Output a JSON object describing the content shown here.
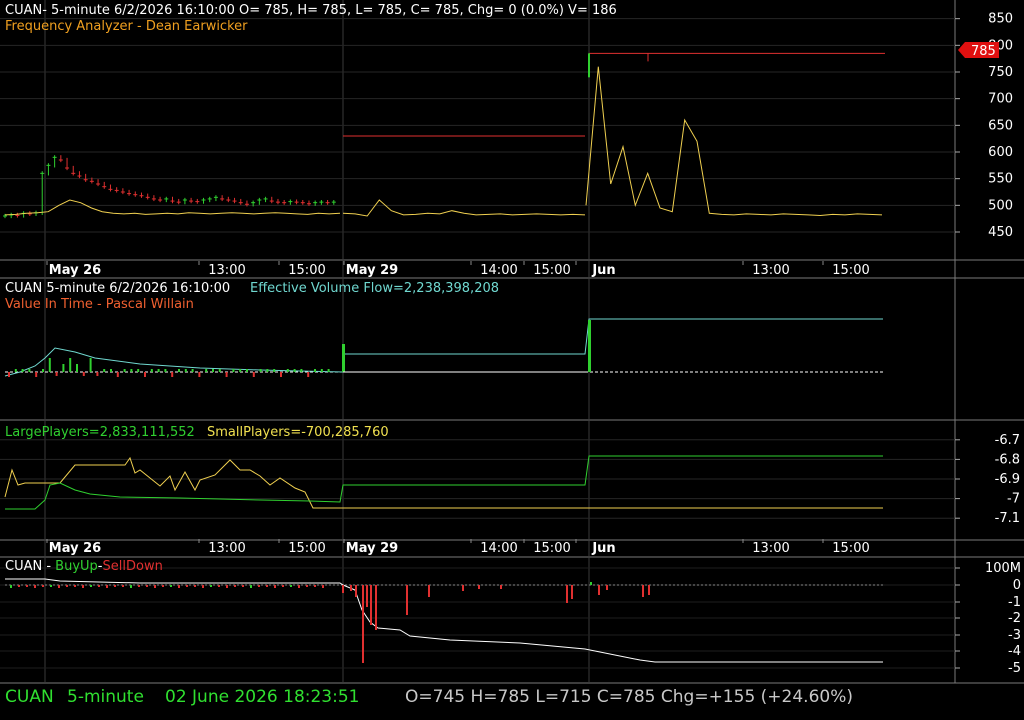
{
  "colors": {
    "background": "#000000",
    "grid": "#2e2e2e",
    "separator": "#7a7a7a",
    "white": "#ffffff",
    "yellow": "#f0d050",
    "orange": "#f08020",
    "red": "#e03030",
    "green": "#30d030",
    "cyan": "#70d8d0",
    "status_green": "#30e030",
    "gray_text": "#c8c8c8"
  },
  "panel1": {
    "header": "CUAN- 5-minute 6/2/2026 16:10:00 O= 785, H= 785, L= 785, C= 785, Chg= 0 (0.0%) V= 186",
    "subtitle": "Frequency Analyzer - Dean Earwicker",
    "last_price_tag": "785"
  },
  "panel2": {
    "header_prefix": "CUAN 5-minute  6/2/2026 16:10:00",
    "header_indicator": "Effective Volume Flow=2,238,398,208",
    "subtitle": "Value In Time - Pascal Willain"
  },
  "panel3": {
    "large_label": "LargePlayers=2,833,111,552",
    "small_label": "SmallPlayers=-700,285,760"
  },
  "panel4": {
    "label_prefix": "CUAN - ",
    "buy_label": "BuyUp",
    "dash": "-",
    "sell_label": "SellDown"
  },
  "status": {
    "symbol": "CUAN",
    "interval": "5-minute",
    "datetime": "02 June 2026 18:23:51",
    "ohlc": "O=745  H=785  L=715  C=785  Chg=+155 (+24.60%)"
  },
  "chart_data": [
    {
      "type": "candlestick",
      "name": "price",
      "ylim": [
        420,
        870
      ],
      "y_ticks": [
        850,
        800,
        750,
        700,
        650,
        600,
        550,
        500,
        450
      ],
      "x_ticks": [
        "May 26",
        "13:00",
        "15:00",
        "May 29",
        "14:00",
        "15:00",
        "Jun",
        "13:00",
        "15:00"
      ],
      "x_ticks_bold": [
        "May 26",
        "May 29",
        "Jun"
      ],
      "candle_closes_may26": [
        480,
        482,
        481,
        485,
        484,
        486,
        560,
        575,
        590,
        585,
        570,
        560,
        555,
        548,
        545,
        540,
        535,
        530,
        528,
        525,
        522,
        520,
        518,
        515,
        512,
        510,
        512,
        508,
        506,
        510,
        508,
        507,
        510,
        512,
        515,
        512,
        510,
        508,
        505,
        502,
        505,
        510,
        512,
        508,
        506,
        505,
        507,
        506,
        505,
        503,
        505,
        506,
        505,
        506
      ],
      "candles_may29": [
        {
          "x": 0.0,
          "value": 630
        },
        {
          "x": 1.0,
          "value": 630
        }
      ],
      "candles_jun": [
        {
          "x": 0.0,
          "value": 785
        },
        {
          "x": 1.0,
          "value": 785
        }
      ],
      "last_close": 785
    },
    {
      "type": "line",
      "name": "Frequency Analyzer",
      "values_may26": [
        482,
        483,
        485,
        486,
        488,
        500,
        510,
        505,
        495,
        488,
        485,
        484,
        485,
        483,
        484,
        485,
        484,
        486,
        485,
        484,
        485,
        486,
        485,
        484,
        485,
        486,
        485,
        484,
        483,
        485,
        484,
        485
      ],
      "values_may29": [
        485,
        484,
        480,
        510,
        490,
        482,
        483,
        485,
        484,
        490,
        485,
        482,
        483,
        484,
        482,
        483,
        484,
        483,
        482,
        483,
        482
      ],
      "values_jun": [
        500,
        760,
        540,
        610,
        500,
        560,
        495,
        488,
        660,
        620,
        485,
        483,
        482,
        484,
        483,
        482,
        484,
        483,
        482,
        481,
        483,
        482,
        484,
        483,
        482
      ]
    },
    {
      "type": "line",
      "name": "Effective Volume Flow",
      "levels": {
        "may26_start": 372,
        "may26_peak": 348,
        "may26_end": 372,
        "may29": 354,
        "jun": 319
      }
    },
    {
      "type": "line",
      "name": "LargePlayers / SmallPlayers",
      "y_ticks": [
        -6.7,
        -6.8,
        -6.9,
        -7,
        -7.1
      ],
      "ylim": [
        -7.15,
        -6.65
      ],
      "large_levels": {
        "may26_start": -7.0,
        "may26_mid": -6.9,
        "may26_end": -6.97,
        "may29": -6.9,
        "jun": -6.78
      },
      "small_levels": {
        "may26_range": [
          -6.92,
          -6.78
        ],
        "may29": -7.0,
        "jun": -7.0
      }
    },
    {
      "type": "bar",
      "name": "BuyUp-SellDown",
      "y_ticks": [
        "100M",
        "0",
        "-1",
        "-2",
        "-3",
        "-4",
        "-5"
      ],
      "cumulative_levels": {
        "may26": 0.05,
        "may29_start": 0.0,
        "may29_mid": -2.5,
        "may29_end": -3.8,
        "jun_end": -4.8
      }
    }
  ]
}
